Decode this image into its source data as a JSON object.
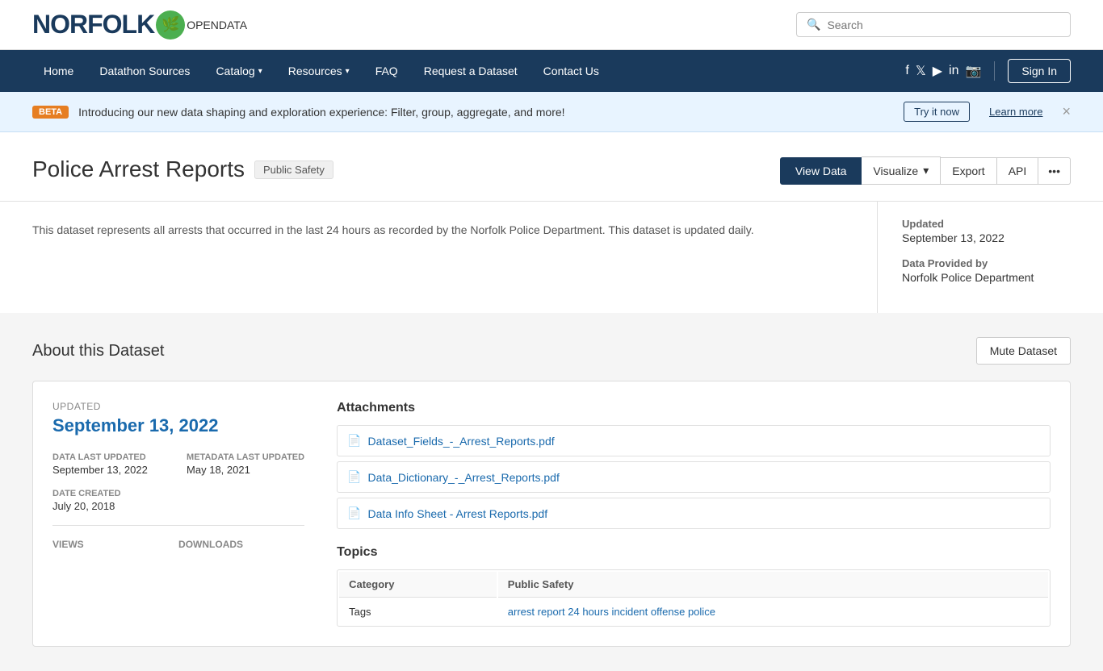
{
  "header": {
    "logo_norfolk": "NORFOLK",
    "logo_opendata": "OPENDATA",
    "search_placeholder": "Search"
  },
  "nav": {
    "items": [
      {
        "label": "Home",
        "has_dropdown": false
      },
      {
        "label": "Datathon Sources",
        "has_dropdown": false
      },
      {
        "label": "Catalog",
        "has_dropdown": true
      },
      {
        "label": "Resources",
        "has_dropdown": true
      },
      {
        "label": "FAQ",
        "has_dropdown": false
      },
      {
        "label": "Request a Dataset",
        "has_dropdown": false
      },
      {
        "label": "Contact Us",
        "has_dropdown": false
      }
    ],
    "sign_in": "Sign In"
  },
  "banner": {
    "beta": "BETA",
    "text": "Introducing our new data shaping and exploration experience: Filter, group, aggregate, and more!",
    "try_now": "Try it now",
    "learn_more": "Learn more"
  },
  "dataset": {
    "title": "Police Arrest Reports",
    "category_badge": "Public Safety",
    "description": "This dataset represents all arrests that occurred in the last 24 hours as recorded by the Norfolk Police Department. This dataset is updated daily.",
    "updated_label": "Updated",
    "updated_value": "September 13, 2022",
    "provider_label": "Data Provided by",
    "provider_value": "Norfolk Police Department",
    "buttons": {
      "view_data": "View Data",
      "visualize": "Visualize",
      "export": "Export",
      "api": "API"
    }
  },
  "about": {
    "title": "About this Dataset",
    "mute_btn": "Mute Dataset",
    "updated_label": "Updated",
    "updated_date": "September 13, 2022",
    "data_last_updated_label": "Data Last Updated",
    "data_last_updated_value": "September 13, 2022",
    "metadata_last_updated_label": "Metadata Last Updated",
    "metadata_last_updated_value": "May 18, 2021",
    "date_created_label": "Date Created",
    "date_created_value": "July 20, 2018",
    "views_label": "Views",
    "downloads_label": "Downloads",
    "attachments_title": "Attachments",
    "attachments": [
      {
        "name": "Dataset_Fields_-_Arrest_Reports.pdf"
      },
      {
        "name": "Data_Dictionary_-_Arrest_Reports.pdf"
      },
      {
        "name": "Data Info Sheet - Arrest Reports.pdf"
      }
    ],
    "topics_title": "Topics",
    "topics_col1": "Category",
    "topics_col2": "Public Safety",
    "tags_col1": "Tags",
    "tags": [
      "arrest",
      "report",
      "24 hours",
      "incident",
      "offense",
      "police"
    ]
  }
}
